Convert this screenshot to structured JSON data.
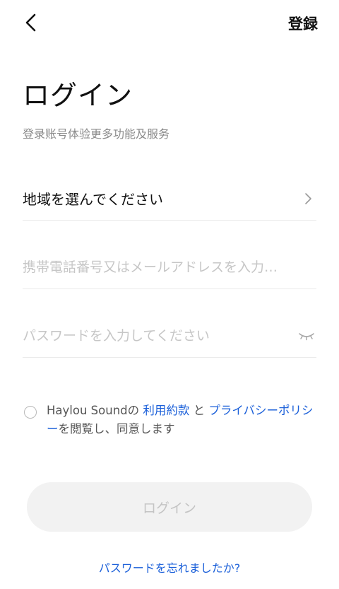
{
  "header": {
    "back_icon": "chevron-left-icon",
    "register_label": "登録"
  },
  "title": "ログイン",
  "subtitle": "登录账号体验更多功能及服务",
  "region": {
    "label": "地域を選んでください",
    "icon": "chevron-right-icon"
  },
  "phone": {
    "placeholder": "携帯電話番号又はメールアドレスを入力…"
  },
  "password": {
    "placeholder": "パスワードを入力してください",
    "icon": "eye-closed-icon"
  },
  "agreement": {
    "prefix": "Haylou Soundの ",
    "terms_link": "利用約款",
    "conjunction": " と ",
    "privacy_link": "プライバシーポリシー",
    "suffix": "を閲覧し、同意します",
    "checked": false
  },
  "login_button": "ログイン",
  "forgot_password": "パスワードを忘れましたか?",
  "colors": {
    "link": "#1a5fd9",
    "button_bg": "#f2f2f2",
    "button_text": "#c4c4c4",
    "placeholder": "#c6c6c6"
  }
}
